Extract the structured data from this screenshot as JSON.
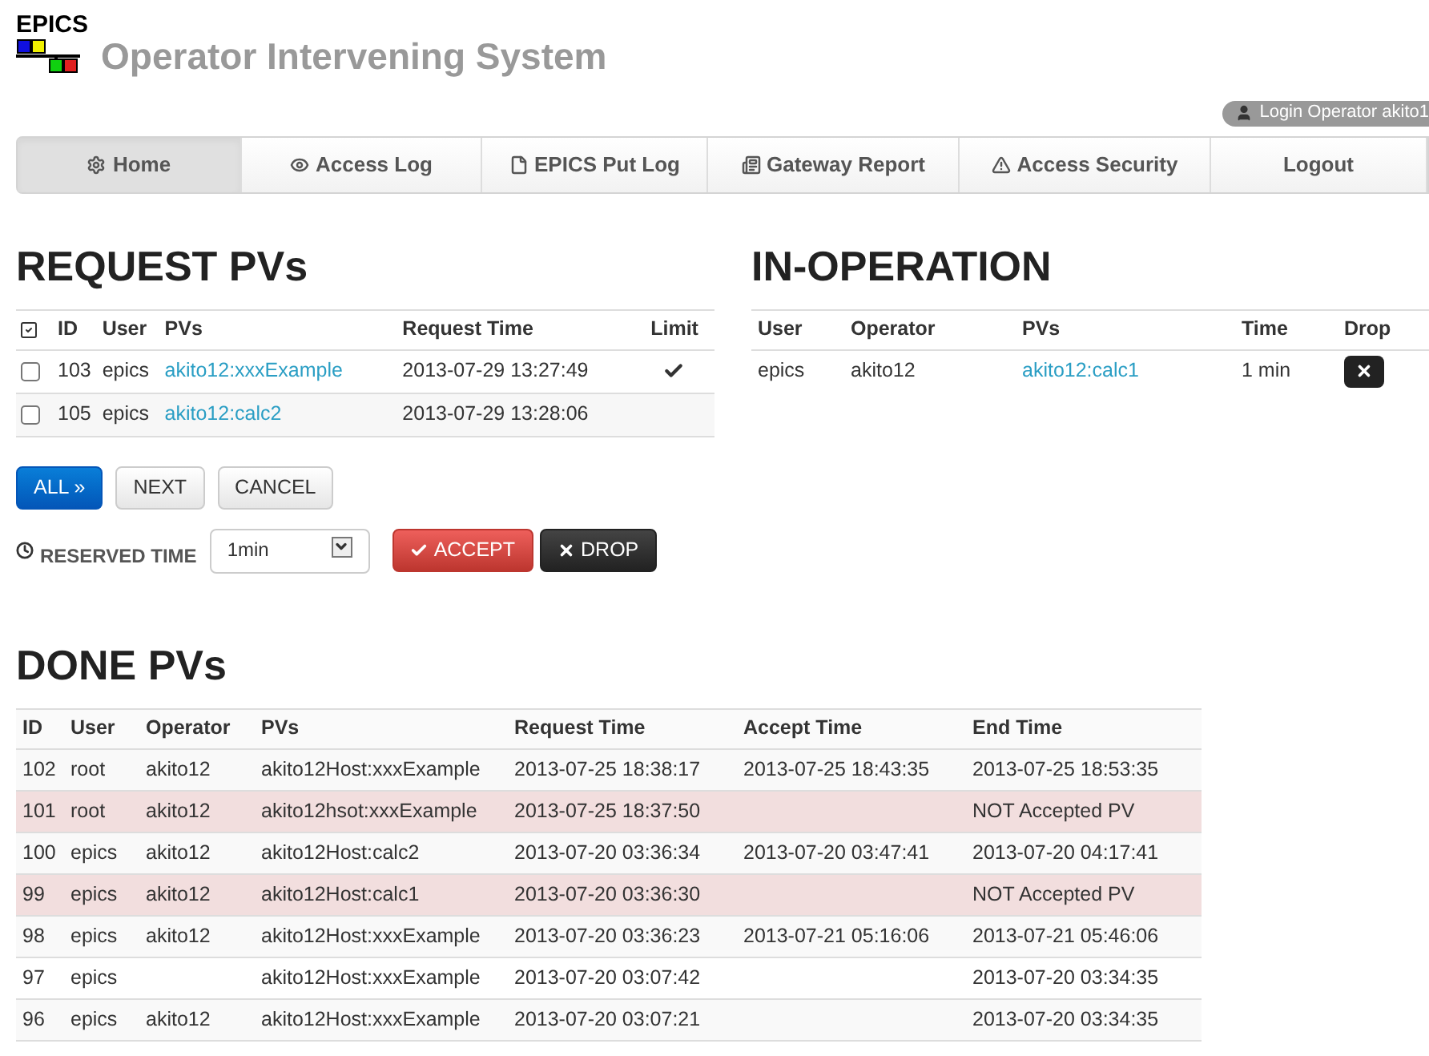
{
  "header": {
    "logo_text": "EPICS",
    "title": "Operator Intervening System",
    "login_badge": "Login Operator akito1"
  },
  "nav": [
    {
      "label": "Home",
      "selected": true
    },
    {
      "label": "Access Log",
      "selected": false
    },
    {
      "label": "EPICS Put Log",
      "selected": false
    },
    {
      "label": "Gateway Report",
      "selected": false
    },
    {
      "label": "Access Security",
      "selected": false
    },
    {
      "label": "Logout",
      "selected": false
    }
  ],
  "request": {
    "title": "REQUEST PVs",
    "columns": [
      "ID",
      "User",
      "PVs",
      "Request Time",
      "Limit"
    ],
    "rows": [
      {
        "checked": false,
        "id": "103",
        "user": "epics",
        "pv": "akito12:xxxExample",
        "time": "2013-07-29 13:27:49",
        "limit": true
      },
      {
        "checked": false,
        "id": "105",
        "user": "epics",
        "pv": "akito12:calc2",
        "time": "2013-07-29 13:28:06",
        "limit": false
      }
    ],
    "buttons": [
      {
        "label": "ALL »",
        "kind": "primary"
      },
      {
        "label": "NEXT",
        "kind": "default"
      },
      {
        "label": "CANCEL",
        "kind": "default"
      }
    ],
    "reserved_label": "RESERVED TIME",
    "reserved_value": "1min",
    "actions": [
      {
        "label": "ACCEPT",
        "kind": "danger"
      },
      {
        "label": "DROP",
        "kind": "dark"
      }
    ]
  },
  "in_operation": {
    "title": "IN-OPERATION",
    "columns": [
      "User",
      "Operator",
      "PVs",
      "Time",
      "Drop"
    ],
    "rows": [
      {
        "user": "epics",
        "operator": "akito12",
        "pv": "akito12:calc1",
        "time": "1 min"
      }
    ]
  },
  "done": {
    "title": "DONE PVs",
    "columns": [
      "ID",
      "User",
      "Operator",
      "PVs",
      "Request Time",
      "Accept Time",
      "End Time"
    ],
    "rows": [
      {
        "accepted": true,
        "cells": [
          "102",
          "root",
          "akito12",
          "akito12Host:xxxExample",
          "2013-07-25 18:38:17",
          "2013-07-25 18:43:35",
          "2013-07-25 18:53:35"
        ]
      },
      {
        "accepted": false,
        "cells": [
          "101",
          "root",
          "akito12",
          "akito12hsot:xxxExample",
          "2013-07-25 18:37:50",
          "",
          "NOT Accepted PV"
        ]
      },
      {
        "accepted": true,
        "cells": [
          "100",
          "epics",
          "akito12",
          "akito12Host:calc2",
          "2013-07-20 03:36:34",
          "2013-07-20 03:47:41",
          "2013-07-20 04:17:41"
        ]
      },
      {
        "accepted": false,
        "cells": [
          "99",
          "epics",
          "akito12",
          "akito12Host:calc1",
          "2013-07-20 03:36:30",
          "",
          "NOT Accepted PV"
        ]
      },
      {
        "accepted": true,
        "cells": [
          "98",
          "epics",
          "akito12",
          "akito12Host:xxxExample",
          "2013-07-20 03:36:23",
          "2013-07-21 05:16:06",
          "2013-07-21 05:46:06"
        ]
      },
      {
        "accepted": true,
        "cells": [
          "97",
          "epics",
          "",
          "akito12Host:xxxExample",
          "2013-07-20 03:07:42",
          "",
          "2013-07-20 03:34:35"
        ]
      },
      {
        "accepted": true,
        "cells": [
          "96",
          "epics",
          "akito12",
          "akito12Host:xxxExample",
          "2013-07-20 03:07:21",
          "",
          "2013-07-20 03:34:35"
        ]
      }
    ]
  }
}
